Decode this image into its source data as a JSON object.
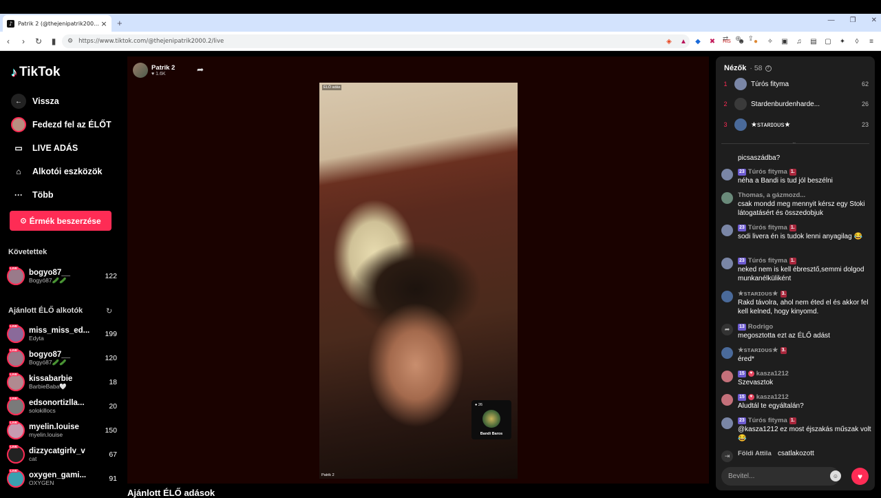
{
  "browser": {
    "tab_title": "Patrik 2 (@thejenipatrik2000...",
    "url": "https://www.tiktok.com/@thejenipatrik2000.2/live"
  },
  "sidebar": {
    "logo": "TikTok",
    "nav": [
      {
        "label": "Vissza",
        "icon": "back-arrow-icon"
      },
      {
        "label": "Fedezd fel az ÉLŐT",
        "icon": "avatar"
      },
      {
        "label": "LIVE ADÁS",
        "icon": "camera-icon"
      },
      {
        "label": "Alkotói eszközök",
        "icon": "creator-tools-icon"
      },
      {
        "label": "Több",
        "icon": "more-icon"
      }
    ],
    "coins_button": "Érmék beszerzése",
    "following_title": "Követettek",
    "following": [
      {
        "username": "bogyo87__",
        "display": "Bogyó87🥒🥒",
        "count": "122"
      }
    ],
    "recommended_title": "Ajánlott ÉLŐ alkotók",
    "recommended": [
      {
        "username": "miss_miss_ed...",
        "display": "Edyta",
        "count": "199",
        "color": "#8a6a9a"
      },
      {
        "username": "bogyo87__",
        "display": "Bogyó87🥒🥒",
        "count": "120",
        "color": "#9a7a8a"
      },
      {
        "username": "kissabarbie",
        "display": "BarbieBaba🤍",
        "count": "18",
        "color": "#b08a90"
      },
      {
        "username": "edsonortizlla...",
        "display": "solokillocs",
        "count": "20",
        "color": "#7a7a7a"
      },
      {
        "username": "myelin.louise",
        "display": "myelin.louise",
        "count": "150",
        "color": "#c79ab0"
      },
      {
        "username": "dizzycatgirlv_v",
        "display": "cat",
        "count": "67",
        "color": "#222222"
      },
      {
        "username": "oxygen_gami...",
        "display": "OXYGEN",
        "count": "91",
        "color": "#3aa0b0"
      }
    ],
    "live_badge": "LIVE"
  },
  "main": {
    "creator_name": "Patrik 2",
    "likes": "♥ 1.6K",
    "video_tag": "ÉLŐ adás",
    "video_caption": "Patrik 2",
    "guest_count": "● 26",
    "guest_name": "Bandi Baros",
    "suggested_title": "Ajánlott ÉLŐ adások"
  },
  "chat": {
    "viewers_label": "Nézők",
    "viewers_count": "· 58",
    "ranking": [
      {
        "rank": "1",
        "name": "Túrós fityma",
        "score": "62"
      },
      {
        "rank": "2",
        "name": "Stardenburdenharde...",
        "score": "26"
      },
      {
        "rank": "3",
        "name": "★sᴛᴀʀɪᴏᴜs★",
        "score": "23"
      }
    ],
    "messages": [
      {
        "name": "",
        "text": "picsaszádba?"
      },
      {
        "name": "Túrós fityma",
        "level": "23",
        "fan": "1.",
        "text": "néha a Bandi is tud jól beszélni"
      },
      {
        "name": "Thomas, a gázmozd...",
        "text": "csak mondd meg mennyit kérsz egy Stoki látogatásért és összedobjuk"
      },
      {
        "name": "Túrós fityma",
        "level": "23",
        "fan": "1.",
        "text": "sodi livera én is tudok lenni anyagilag 😂"
      },
      {
        "name": "Túrós fityma",
        "level": "23",
        "fan": "1.",
        "text": "neked nem is kell ébresztő,semmi dolgod munkanélküliként"
      },
      {
        "name": "★sᴛᴀʀɪᴏᴜs★",
        "fan": "3.",
        "text": "Rakd távolra, ahol nem éted el és akkor fel kell kelned, hogy kinyomd."
      },
      {
        "name": "Rodrigo",
        "level": "13",
        "text": "megosztotta ezt az ÉLŐ adást"
      },
      {
        "name": "★sᴛᴀʀɪᴏᴜs★",
        "fan": "3.",
        "text": "éred*"
      },
      {
        "name": "kasza1212",
        "level": "15",
        "text": "Szevasztok"
      },
      {
        "name": "kasza1212",
        "level": "15",
        "text": "Aludtál te egyáltalán?"
      },
      {
        "name": "Túrós fityma",
        "level": "23",
        "fan": "1.",
        "text": "@kasza1212 ez most éjszakás műszak volt😂"
      },
      {
        "name": "Földi Attila",
        "text": "csatlakozott"
      }
    ],
    "input_placeholder": "Bevitel..."
  }
}
